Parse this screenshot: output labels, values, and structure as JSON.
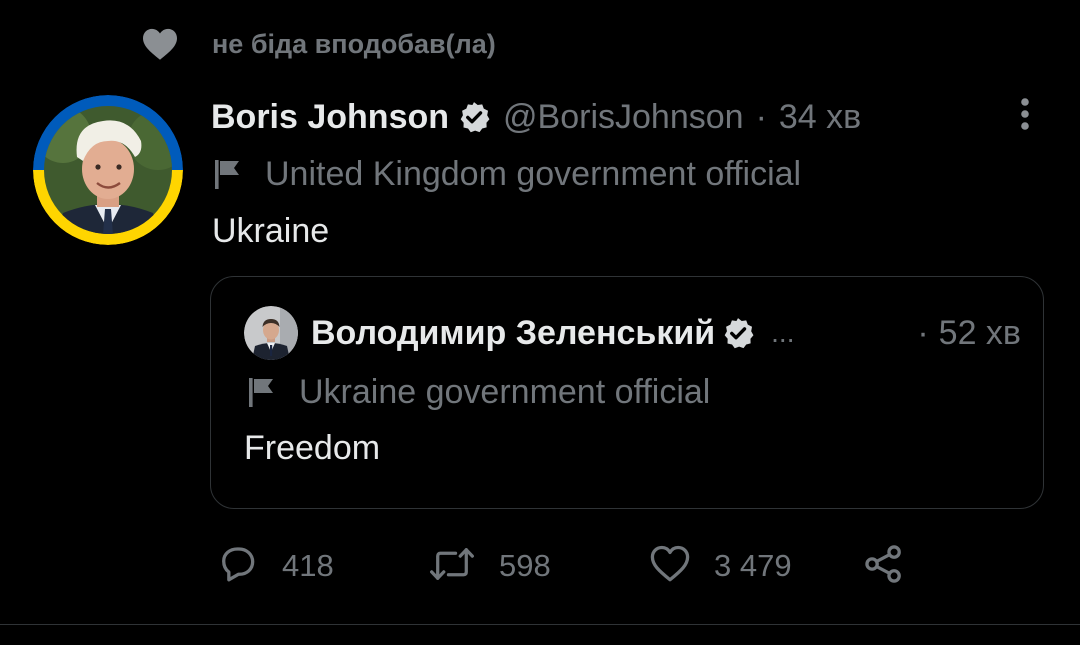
{
  "social_context": {
    "icon": "heart-filled-icon",
    "text": "не біда вподобав(ла)"
  },
  "tweet": {
    "author": {
      "name": "Boris Johnson",
      "verified_icon": "verified-badge-icon",
      "handle": "@BorisJohnson",
      "avatar": "avatar-boris-johnson"
    },
    "separator": "·",
    "time": "34 хв",
    "more_icon": "more-vertical-icon",
    "label": {
      "icon": "flag-icon",
      "text": "United Kingdom government official"
    },
    "text": "Ukraine"
  },
  "quote": {
    "author": {
      "name": "Володимир Зеленський",
      "verified_icon": "verified-badge-icon",
      "avatar": "avatar-zelensky"
    },
    "ellipsis": "...",
    "separator": "·",
    "time": "52 хв",
    "label": {
      "icon": "flag-icon",
      "text": "Ukraine government official"
    },
    "text": "Freedom"
  },
  "actions": {
    "reply": {
      "icon": "reply-icon",
      "count": "418"
    },
    "retweet": {
      "icon": "retweet-icon",
      "count": "598"
    },
    "like": {
      "icon": "heart-outline-icon",
      "count": "3 479"
    },
    "share": {
      "icon": "share-icon"
    }
  },
  "colors": {
    "background": "#000000",
    "primary_text": "#e7e9ea",
    "secondary_text": "#71767b",
    "border": "#2f3336",
    "ukraine_blue": "#005bbb",
    "ukraine_yellow": "#ffd500"
  }
}
